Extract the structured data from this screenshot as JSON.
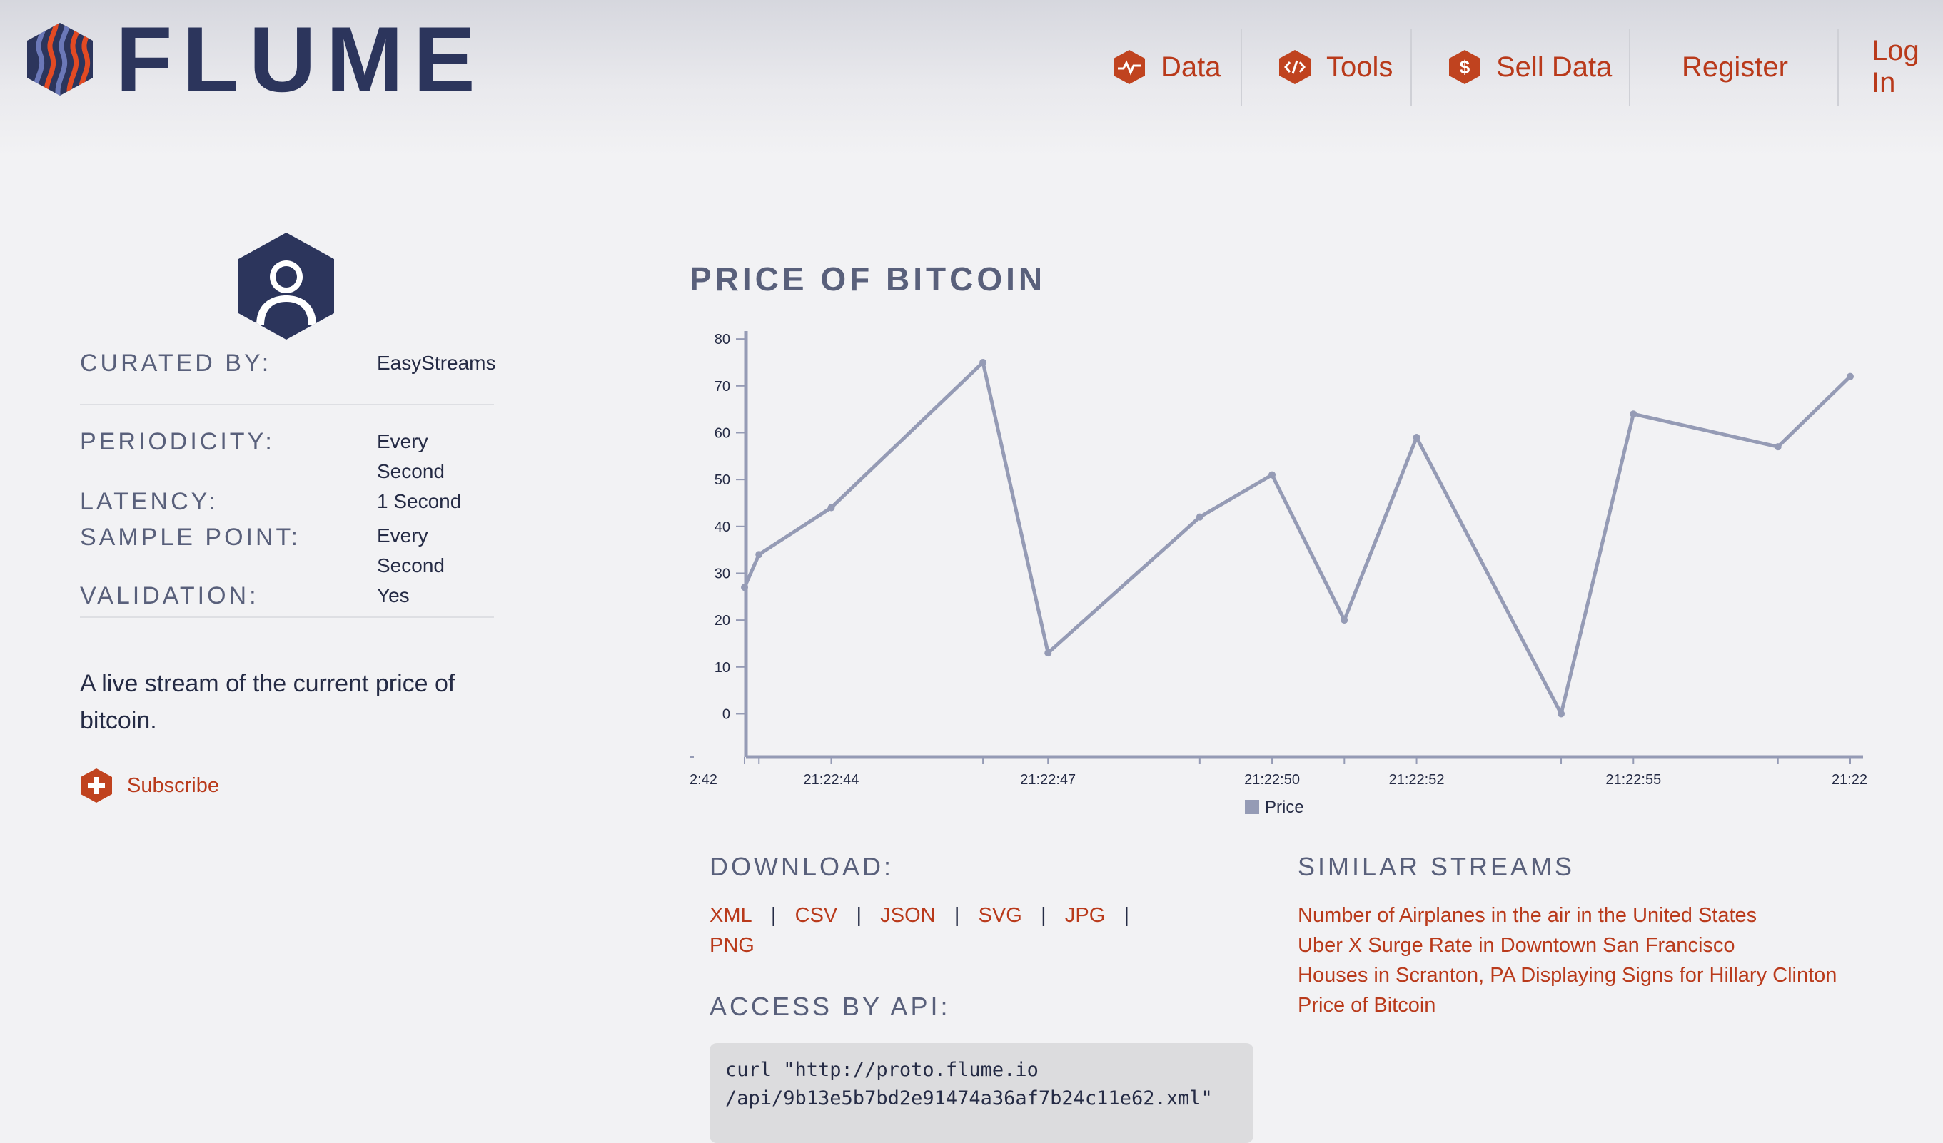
{
  "brand": {
    "name": "FLUME"
  },
  "nav": {
    "items": [
      {
        "label": "Data",
        "icon": "activity-icon"
      },
      {
        "label": "Tools",
        "icon": "code-icon"
      },
      {
        "label": "Sell Data",
        "icon": "dollar-icon"
      },
      {
        "label": "Register"
      },
      {
        "label": "Log In"
      }
    ]
  },
  "stream": {
    "curated_label": "CURATED BY:",
    "curated_value": "EasyStreams",
    "periodicity_label": "PERIODICITY:",
    "periodicity_value_1": "Every",
    "periodicity_value_2": "Second",
    "latency_label": "LATENCY:",
    "latency_value": "1 Second",
    "sample_label": "SAMPLE POINT:",
    "sample_value_1": "Every",
    "sample_value_2": "Second",
    "validation_label": "VALIDATION:",
    "validation_value": "Yes",
    "description": "A live stream of the current price of bitcoin.",
    "subscribe_label": "Subscribe"
  },
  "chart_data": {
    "type": "line",
    "title": "PRICE OF BITCOIN",
    "y_ticks": [
      "80",
      "70",
      "60",
      "50",
      "40",
      "30",
      "20",
      "10",
      "0"
    ],
    "x_tick_labels": [
      "2:42",
      "21:22:44",
      "21:22:47",
      "21:22:50",
      "21:22:52",
      "21:22:55",
      "21:22"
    ],
    "ylim": [
      -8,
      82
    ],
    "series": [
      {
        "name": "Price",
        "color": "#959bb5",
        "points": [
          {
            "t": 42.0,
            "y": 27
          },
          {
            "t": 42.2,
            "y": 34
          },
          {
            "t": 43.2,
            "y": 44
          },
          {
            "t": 45.3,
            "y": 75
          },
          {
            "t": 46.2,
            "y": 13
          },
          {
            "t": 48.3,
            "y": 42
          },
          {
            "t": 49.3,
            "y": 51
          },
          {
            "t": 50.3,
            "y": 20
          },
          {
            "t": 51.3,
            "y": 59
          },
          {
            "t": 53.3,
            "y": 0
          },
          {
            "t": 54.3,
            "y": 64
          },
          {
            "t": 56.3,
            "y": 57
          },
          {
            "t": 57.3,
            "y": 72
          }
        ]
      }
    ],
    "legend": "bottom-center"
  },
  "download": {
    "title": "DOWNLOAD:",
    "formats": [
      "XML",
      "CSV",
      "JSON",
      "SVG",
      "JPG",
      "PNG"
    ],
    "separator": "|"
  },
  "api": {
    "title": "ACCESS BY API:",
    "line1": "curl \"http://proto.flume.io",
    "line2": "/api/9b13e5b7bd2e91474a36af7b24c11e62.xml\""
  },
  "similar": {
    "title": "SIMILAR STREAMS",
    "items": [
      "Number of Airplanes in the air in the United States",
      "Uber X Surge Rate in Downtown San Francisco",
      "Houses in Scranton, PA Displaying Signs for Hillary Clinton",
      "Price of Bitcoin"
    ]
  },
  "colors": {
    "accent": "#b93a1b",
    "brand_navy": "#2c355c",
    "line": "#959bb5"
  }
}
